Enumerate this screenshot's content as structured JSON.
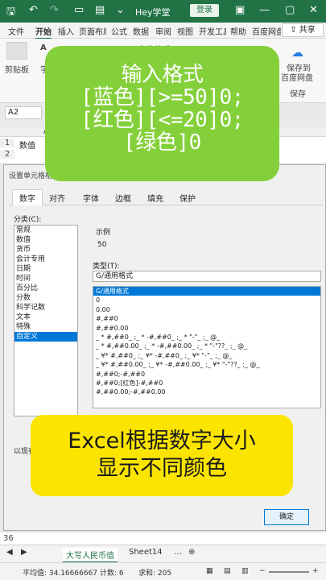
{
  "titlebar": {
    "title": "Hey学堂",
    "login": "登录"
  },
  "ribbon_tabs": [
    "文件",
    "开始",
    "插入",
    "页面布局",
    "公式",
    "数据",
    "审阅",
    "视图",
    "开发工具",
    "帮助",
    "百度网盘"
  ],
  "share": "共享",
  "ribbon": {
    "clipboard": "剪贴板",
    "font_frag": "字",
    "cond_format": "条件格式",
    "save_to": "保存到",
    "baidu_disk": "百度网盘",
    "save": "保存"
  },
  "namebox": "A2",
  "grid": {
    "col_a": "A",
    "rows": [
      {
        "num": "1",
        "value": "数值"
      },
      {
        "num": "2",
        "value": ""
      }
    ]
  },
  "dialog": {
    "title": "设置单元格格式",
    "tabs": [
      "数字",
      "对齐",
      "字体",
      "边框",
      "填充",
      "保护"
    ],
    "category_label": "分类(C):",
    "categories": [
      "常规",
      "数值",
      "货币",
      "会计专用",
      "日期",
      "时间",
      "百分比",
      "分数",
      "科学记数",
      "文本",
      "特殊",
      "自定义"
    ],
    "selected_category": "自定义",
    "sample_label": "示例",
    "sample_value": "50",
    "type_label": "类型(T):",
    "type_value": "G/通用格式",
    "formats": [
      "G/通用格式",
      "0",
      "0.00",
      "#,##0",
      "#,##0.00",
      "_ * #,##0_ ;_ * -#,##0_ ;_ * \"-\"_ ;_ @_",
      "_ * #,##0.00_ ;_ * -#,##0.00_ ;_ * \"-\"??_ ;_ @_",
      "_ ¥* #,##0_ ;_ ¥* -#,##0_ ;_ ¥* \"-\"_ ;_ @_",
      "_ ¥* #,##0.00_ ;_ ¥* -#,##0.00_ ;_ ¥* \"-\"??_ ;_ @_",
      "#,##0;-#,##0",
      "#,##0;[红色]-#,##0",
      "#,##0.00;-#,##0.00"
    ],
    "left_note": "以现有",
    "ok": "确定"
  },
  "overlay_green": {
    "lines": [
      "输入格式",
      "[蓝色][>=50]0;",
      "[红色][<=20]0;",
      "[绿色]0"
    ]
  },
  "overlay_yellow": {
    "lines": [
      "Excel根据数字大小",
      "显示不同颜色"
    ]
  },
  "sheetbar": {
    "row_num": "36",
    "tabs": [
      "大写人民币值",
      "Sheet14"
    ],
    "active_tab": "大写人民币值"
  },
  "statusbar": {
    "average": "平均值: 34.16666667",
    "count": "计数: 6",
    "sum": "求和: 205"
  }
}
